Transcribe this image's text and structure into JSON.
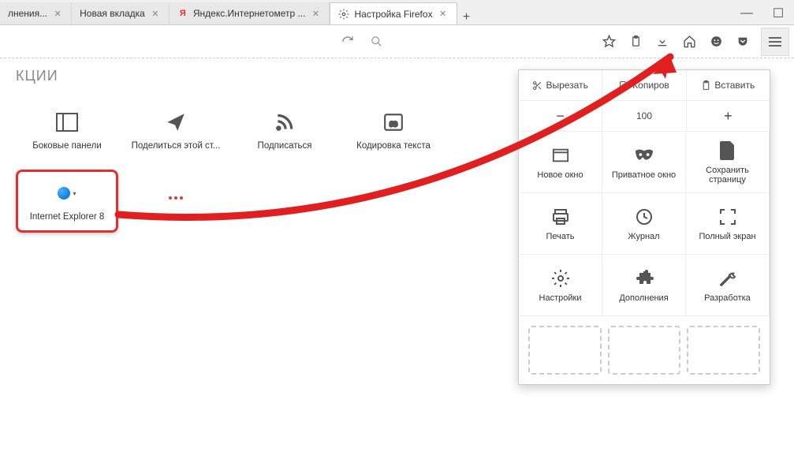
{
  "tabs": [
    {
      "label": "лнения...",
      "favicon": ""
    },
    {
      "label": "Новая вкладка",
      "favicon": ""
    },
    {
      "label": "Яндекс.Интернетометр ...",
      "favicon": "Я"
    },
    {
      "label": "Настройка Firefox",
      "favicon": "⚙",
      "active": true
    }
  ],
  "section_title": "КЦИИ",
  "toolbar": {
    "search_placeholder": ""
  },
  "tools": [
    {
      "label": "Боковые панели",
      "icon": "sidebar"
    },
    {
      "label": "Поделиться этой ст...",
      "icon": "paperplane"
    },
    {
      "label": "Подписаться",
      "icon": "rss"
    },
    {
      "label": "Кодировка текста",
      "icon": "encoding"
    },
    {
      "label": "Internet Explorer 8",
      "icon": "ie",
      "highlight": true
    },
    {
      "label": "",
      "icon": "lastpass"
    }
  ],
  "menu": {
    "clipboard": {
      "cut": "Вырезать",
      "copy": "Копиров",
      "paste": "Вставить"
    },
    "zoom": {
      "value": "100"
    },
    "items": [
      {
        "label": "Новое окно",
        "icon": "window"
      },
      {
        "label": "Приватное окно",
        "icon": "mask"
      },
      {
        "label": "Сохранить страницу",
        "icon": "file"
      },
      {
        "label": "Печать",
        "icon": "print"
      },
      {
        "label": "Журнал",
        "icon": "clock"
      },
      {
        "label": "Полный экран",
        "icon": "fullscreen"
      },
      {
        "label": "Настройки",
        "icon": "gear"
      },
      {
        "label": "Дополнения",
        "icon": "puzzle"
      },
      {
        "label": "Разработка",
        "icon": "wrench"
      }
    ]
  }
}
